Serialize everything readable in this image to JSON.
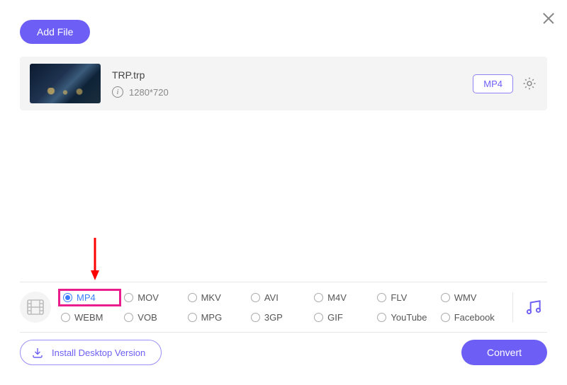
{
  "header": {
    "add_file_label": "Add File"
  },
  "file": {
    "name": "TRP.trp",
    "resolution": "1280*720",
    "output_format": "MP4"
  },
  "formats": {
    "row1": [
      "MP4",
      "MOV",
      "MKV",
      "AVI",
      "M4V",
      "FLV",
      "WMV"
    ],
    "row2": [
      "WEBM",
      "VOB",
      "MPG",
      "3GP",
      "GIF",
      "YouTube",
      "Facebook"
    ],
    "selected": "MP4"
  },
  "footer": {
    "install_label": "Install Desktop Version",
    "convert_label": "Convert"
  }
}
